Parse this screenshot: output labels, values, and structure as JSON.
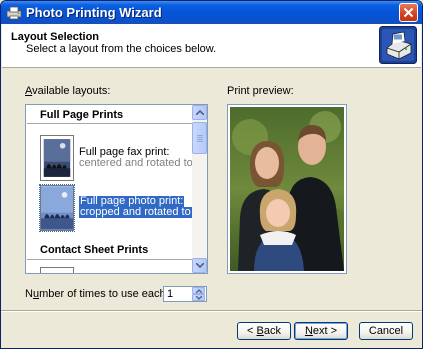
{
  "window": {
    "title": "Photo Printing Wizard",
    "icon": "photo-printing-wizard-icon"
  },
  "header": {
    "title": "Layout Selection",
    "subtitle": "Select a layout from the choices below.",
    "icon": "printer-icon"
  },
  "layouts": {
    "label_prefix": "",
    "label_mnemonic": "A",
    "label_rest": "vailable layouts:",
    "groups": [
      {
        "title": "Full Page Prints",
        "items": [
          {
            "line1": "Full page fax print:",
            "line2": "centered and rotated to fit",
            "selected": false
          },
          {
            "line1": "Full page photo print:",
            "line2": "cropped and rotated to fit",
            "selected": true
          }
        ]
      },
      {
        "title": "Contact Sheet Prints",
        "items": []
      }
    ]
  },
  "preview": {
    "label": "Print preview:"
  },
  "copies": {
    "label_prefix": "N",
    "label_mnemonic": "u",
    "label_rest": "mber of times to use each picture:",
    "value": "1"
  },
  "buttons": {
    "back_arrow": "< ",
    "back_mnemonic": "B",
    "back_rest": "ack",
    "next_mnemonic": "N",
    "next_rest": "ext >",
    "cancel": "Cancel"
  },
  "colors": {
    "accent": "#316ac5",
    "titlebar": "#0554d8",
    "dialog_bg": "#ece9d8"
  }
}
